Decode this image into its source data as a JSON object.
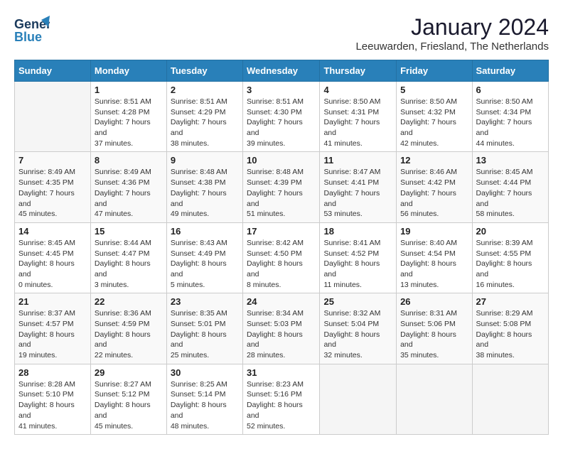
{
  "header": {
    "logo_line1": "General",
    "logo_line2": "Blue",
    "main_title": "January 2024",
    "subtitle": "Leeuwarden, Friesland, The Netherlands"
  },
  "days_of_week": [
    "Sunday",
    "Monday",
    "Tuesday",
    "Wednesday",
    "Thursday",
    "Friday",
    "Saturday"
  ],
  "weeks": [
    [
      {
        "day": "",
        "sunrise": "",
        "sunset": "",
        "daylight": ""
      },
      {
        "day": "1",
        "sunrise": "Sunrise: 8:51 AM",
        "sunset": "Sunset: 4:28 PM",
        "daylight": "Daylight: 7 hours and 37 minutes."
      },
      {
        "day": "2",
        "sunrise": "Sunrise: 8:51 AM",
        "sunset": "Sunset: 4:29 PM",
        "daylight": "Daylight: 7 hours and 38 minutes."
      },
      {
        "day": "3",
        "sunrise": "Sunrise: 8:51 AM",
        "sunset": "Sunset: 4:30 PM",
        "daylight": "Daylight: 7 hours and 39 minutes."
      },
      {
        "day": "4",
        "sunrise": "Sunrise: 8:50 AM",
        "sunset": "Sunset: 4:31 PM",
        "daylight": "Daylight: 7 hours and 41 minutes."
      },
      {
        "day": "5",
        "sunrise": "Sunrise: 8:50 AM",
        "sunset": "Sunset: 4:32 PM",
        "daylight": "Daylight: 7 hours and 42 minutes."
      },
      {
        "day": "6",
        "sunrise": "Sunrise: 8:50 AM",
        "sunset": "Sunset: 4:34 PM",
        "daylight": "Daylight: 7 hours and 44 minutes."
      }
    ],
    [
      {
        "day": "7",
        "sunrise": "Sunrise: 8:49 AM",
        "sunset": "Sunset: 4:35 PM",
        "daylight": "Daylight: 7 hours and 45 minutes."
      },
      {
        "day": "8",
        "sunrise": "Sunrise: 8:49 AM",
        "sunset": "Sunset: 4:36 PM",
        "daylight": "Daylight: 7 hours and 47 minutes."
      },
      {
        "day": "9",
        "sunrise": "Sunrise: 8:48 AM",
        "sunset": "Sunset: 4:38 PM",
        "daylight": "Daylight: 7 hours and 49 minutes."
      },
      {
        "day": "10",
        "sunrise": "Sunrise: 8:48 AM",
        "sunset": "Sunset: 4:39 PM",
        "daylight": "Daylight: 7 hours and 51 minutes."
      },
      {
        "day": "11",
        "sunrise": "Sunrise: 8:47 AM",
        "sunset": "Sunset: 4:41 PM",
        "daylight": "Daylight: 7 hours and 53 minutes."
      },
      {
        "day": "12",
        "sunrise": "Sunrise: 8:46 AM",
        "sunset": "Sunset: 4:42 PM",
        "daylight": "Daylight: 7 hours and 56 minutes."
      },
      {
        "day": "13",
        "sunrise": "Sunrise: 8:45 AM",
        "sunset": "Sunset: 4:44 PM",
        "daylight": "Daylight: 7 hours and 58 minutes."
      }
    ],
    [
      {
        "day": "14",
        "sunrise": "Sunrise: 8:45 AM",
        "sunset": "Sunset: 4:45 PM",
        "daylight": "Daylight: 8 hours and 0 minutes."
      },
      {
        "day": "15",
        "sunrise": "Sunrise: 8:44 AM",
        "sunset": "Sunset: 4:47 PM",
        "daylight": "Daylight: 8 hours and 3 minutes."
      },
      {
        "day": "16",
        "sunrise": "Sunrise: 8:43 AM",
        "sunset": "Sunset: 4:49 PM",
        "daylight": "Daylight: 8 hours and 5 minutes."
      },
      {
        "day": "17",
        "sunrise": "Sunrise: 8:42 AM",
        "sunset": "Sunset: 4:50 PM",
        "daylight": "Daylight: 8 hours and 8 minutes."
      },
      {
        "day": "18",
        "sunrise": "Sunrise: 8:41 AM",
        "sunset": "Sunset: 4:52 PM",
        "daylight": "Daylight: 8 hours and 11 minutes."
      },
      {
        "day": "19",
        "sunrise": "Sunrise: 8:40 AM",
        "sunset": "Sunset: 4:54 PM",
        "daylight": "Daylight: 8 hours and 13 minutes."
      },
      {
        "day": "20",
        "sunrise": "Sunrise: 8:39 AM",
        "sunset": "Sunset: 4:55 PM",
        "daylight": "Daylight: 8 hours and 16 minutes."
      }
    ],
    [
      {
        "day": "21",
        "sunrise": "Sunrise: 8:37 AM",
        "sunset": "Sunset: 4:57 PM",
        "daylight": "Daylight: 8 hours and 19 minutes."
      },
      {
        "day": "22",
        "sunrise": "Sunrise: 8:36 AM",
        "sunset": "Sunset: 4:59 PM",
        "daylight": "Daylight: 8 hours and 22 minutes."
      },
      {
        "day": "23",
        "sunrise": "Sunrise: 8:35 AM",
        "sunset": "Sunset: 5:01 PM",
        "daylight": "Daylight: 8 hours and 25 minutes."
      },
      {
        "day": "24",
        "sunrise": "Sunrise: 8:34 AM",
        "sunset": "Sunset: 5:03 PM",
        "daylight": "Daylight: 8 hours and 28 minutes."
      },
      {
        "day": "25",
        "sunrise": "Sunrise: 8:32 AM",
        "sunset": "Sunset: 5:04 PM",
        "daylight": "Daylight: 8 hours and 32 minutes."
      },
      {
        "day": "26",
        "sunrise": "Sunrise: 8:31 AM",
        "sunset": "Sunset: 5:06 PM",
        "daylight": "Daylight: 8 hours and 35 minutes."
      },
      {
        "day": "27",
        "sunrise": "Sunrise: 8:29 AM",
        "sunset": "Sunset: 5:08 PM",
        "daylight": "Daylight: 8 hours and 38 minutes."
      }
    ],
    [
      {
        "day": "28",
        "sunrise": "Sunrise: 8:28 AM",
        "sunset": "Sunset: 5:10 PM",
        "daylight": "Daylight: 8 hours and 41 minutes."
      },
      {
        "day": "29",
        "sunrise": "Sunrise: 8:27 AM",
        "sunset": "Sunset: 5:12 PM",
        "daylight": "Daylight: 8 hours and 45 minutes."
      },
      {
        "day": "30",
        "sunrise": "Sunrise: 8:25 AM",
        "sunset": "Sunset: 5:14 PM",
        "daylight": "Daylight: 8 hours and 48 minutes."
      },
      {
        "day": "31",
        "sunrise": "Sunrise: 8:23 AM",
        "sunset": "Sunset: 5:16 PM",
        "daylight": "Daylight: 8 hours and 52 minutes."
      },
      {
        "day": "",
        "sunrise": "",
        "sunset": "",
        "daylight": ""
      },
      {
        "day": "",
        "sunrise": "",
        "sunset": "",
        "daylight": ""
      },
      {
        "day": "",
        "sunrise": "",
        "sunset": "",
        "daylight": ""
      }
    ]
  ]
}
